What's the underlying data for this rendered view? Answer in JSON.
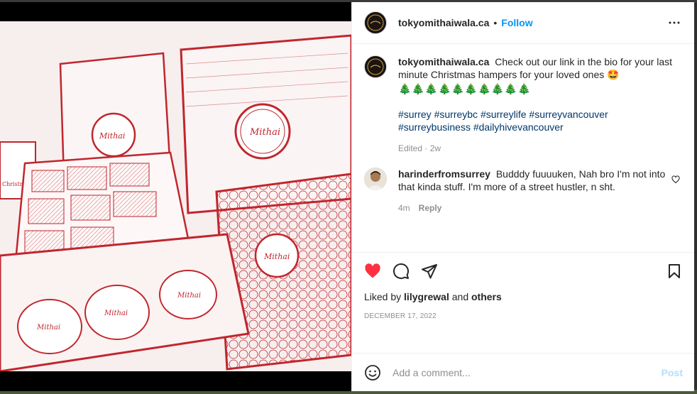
{
  "post": {
    "username": "tokyomithaiwala.ca",
    "follow_label": "Follow",
    "separator": "•",
    "caption": "Check out our link in the bio for your last minute Christmas hampers for your loved ones 🤩",
    "trees": "🎄🎄🎄🎄🎄🎄🎄🎄🎄🎄",
    "hashtags": [
      "#surrey",
      "#surreybc",
      "#surreylife",
      "#surreyvancouver",
      "#surreybusiness",
      "#dailyhivevancouver"
    ],
    "caption_meta": "Edited · 2w",
    "photo_alt": "Tokyo MithaiWala"
  },
  "comments": [
    {
      "username": "harinderfromsurrey",
      "text": "Budddy fuuuuken, Nah bro I'm not into that kinda stuff. I'm more of a street hustler, n sht.",
      "time": "4m",
      "reply_label": "Reply"
    }
  ],
  "engagement": {
    "liked_prefix": "Liked by",
    "liked_user": "lilygrewal",
    "liked_and": "and",
    "liked_others": "others",
    "date": "DECEMBER 17, 2022",
    "liked": true
  },
  "composer": {
    "placeholder": "Add a comment...",
    "post_label": "Post"
  },
  "icons": [
    "more-options-icon",
    "heart-icon",
    "comment-icon",
    "share-icon",
    "bookmark-icon",
    "emoji-icon",
    "like-comment-icon"
  ],
  "colors": {
    "accent": "#0095f6",
    "heart": "#ff3040",
    "post_disabled": "#b2dffc",
    "photo_tint": "#c0262d"
  }
}
